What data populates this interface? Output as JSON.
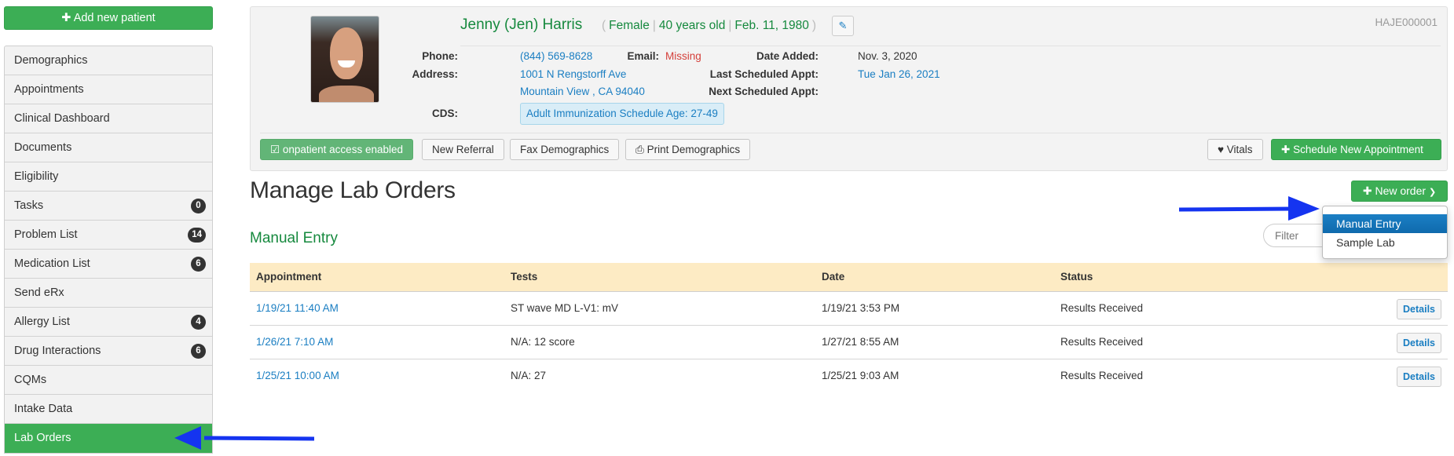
{
  "sidebar": {
    "add_patient_label": "Add new patient",
    "items": [
      {
        "label": "Demographics",
        "badge": null
      },
      {
        "label": "Appointments",
        "badge": null
      },
      {
        "label": "Clinical Dashboard",
        "badge": null
      },
      {
        "label": "Documents",
        "badge": null
      },
      {
        "label": "Eligibility",
        "badge": null
      },
      {
        "label": "Tasks",
        "badge": "0"
      },
      {
        "label": "Problem List",
        "badge": "14"
      },
      {
        "label": "Medication List",
        "badge": "6"
      },
      {
        "label": "Send eRx",
        "badge": null
      },
      {
        "label": "Allergy List",
        "badge": "4"
      },
      {
        "label": "Drug Interactions",
        "badge": "6"
      },
      {
        "label": "CQMs",
        "badge": null
      },
      {
        "label": "Intake Data",
        "badge": null
      },
      {
        "label": "Lab Orders",
        "badge": null,
        "active": true
      }
    ]
  },
  "patient": {
    "name": "Jenny (Jen) Harris",
    "gender": "Female",
    "age": "40 years old",
    "dob": "Feb. 11, 1980",
    "id": "HAJE000001",
    "phone_label": "Phone:",
    "phone": "(844) 569-8628",
    "email_label": "Email:",
    "email": "Missing",
    "address_label": "Address:",
    "address_line1": "1001 N Rengstorff Ave",
    "address_line2": "Mountain View , CA 94040",
    "cds_label": "CDS:",
    "cds": "Adult Immunization Schedule Age: 27-49",
    "date_added_label": "Date Added:",
    "date_added": "Nov. 3, 2020",
    "last_appt_label": "Last Scheduled Appt:",
    "last_appt": "Tue Jan 26, 2021",
    "next_appt_label": "Next Scheduled Appt:",
    "next_appt": ""
  },
  "header_buttons": {
    "onpatient": "onpatient access enabled",
    "new_referral": "New Referral",
    "fax_demographics": "Fax Demographics",
    "print_demographics": "Print Demographics",
    "vitals": "Vitals",
    "schedule": "Schedule New Appointment"
  },
  "main": {
    "title": "Manage Lab Orders",
    "new_order_label": "New order",
    "dropdown_items": [
      "Manual Entry",
      "Sample Lab"
    ],
    "dropdown_active": "Manual Entry",
    "filter_placeholder": "Filter",
    "section_title": "Manual Entry",
    "table": {
      "columns": [
        "Appointment",
        "Tests",
        "Date",
        "Status",
        ""
      ],
      "rows": [
        {
          "appointment": "1/19/21 11:40 AM",
          "tests": "ST wave MD L-V1: mV",
          "date": "1/19/21 3:53 PM",
          "status": "Results Received",
          "action": "Details"
        },
        {
          "appointment": "1/26/21 7:10 AM",
          "tests": "N/A: 12 score",
          "date": "1/27/21 8:55 AM",
          "status": "Results Received",
          "action": "Details"
        },
        {
          "appointment": "1/25/21 10:00 AM",
          "tests": "N/A: 27",
          "date": "1/25/21 9:03 AM",
          "status": "Results Received",
          "action": "Details"
        }
      ]
    }
  },
  "colors": {
    "brand_green": "#3cae55",
    "link_blue": "#1a7ec2",
    "table_header": "#fdebc4",
    "annotation_arrow": "#1534f0"
  }
}
